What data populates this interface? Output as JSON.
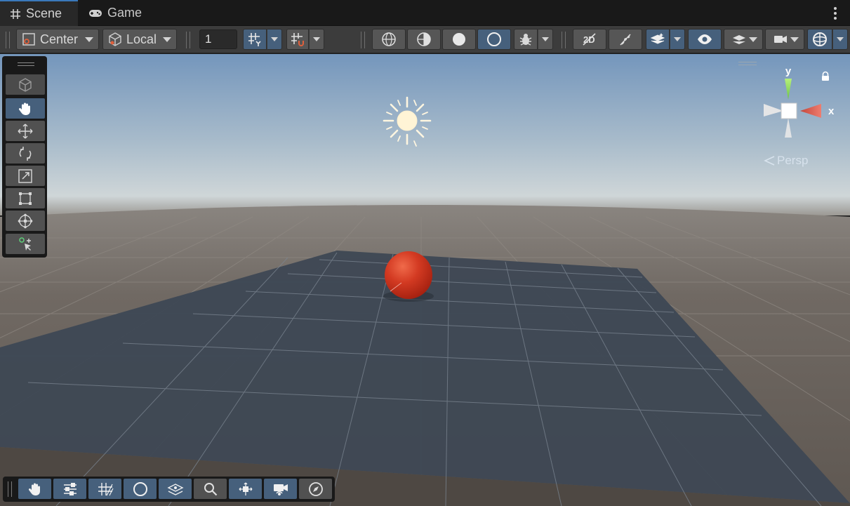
{
  "tabs": [
    {
      "label": "Scene",
      "icon": "grid-hash-icon",
      "active": true
    },
    {
      "label": "Game",
      "icon": "gamepad-icon",
      "active": false
    }
  ],
  "toolbar": {
    "pivot_mode": "Center",
    "pivot_rotation": "Local",
    "grid_size_value": "1",
    "accent_color": "#46607c"
  },
  "gizmo": {
    "y_label": "y",
    "x_label": "x",
    "projection_label": "Persp"
  },
  "scene": {
    "sky_top_color": "#7ea0c4",
    "horizon_color": "#c9d2d6",
    "ground_color": "#6b645d",
    "plane_color": "#3f4a56",
    "sphere_color": "#d23a20"
  },
  "left_tools": [
    "view-tool",
    "hand-tool",
    "move-tool",
    "rotate-tool",
    "scale-tool",
    "rect-tool",
    "transform-tool",
    "custom-tool"
  ],
  "overlay_tools": [
    "hand-icon",
    "sliders-icon",
    "grid-icon",
    "shading-icon",
    "layers-icon",
    "search-icon",
    "pivot-icon",
    "camera-icon",
    "compass-icon"
  ]
}
